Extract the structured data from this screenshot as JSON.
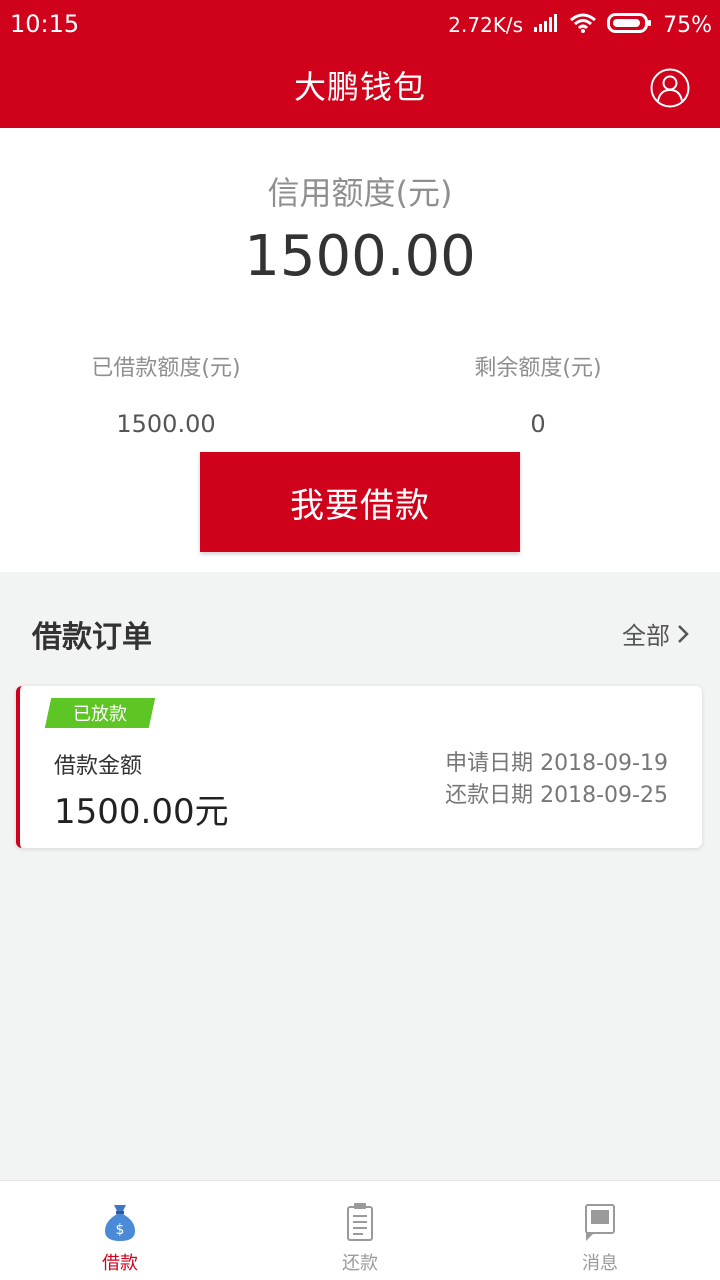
{
  "status": {
    "time": "10:15",
    "speed": "2.72K/s",
    "battery": "75%"
  },
  "header": {
    "title": "大鹏钱包"
  },
  "credit": {
    "label": "信用额度(元)",
    "value": "1500.00",
    "borrowed_label": "已借款额度(元)",
    "borrowed_value": "1500.00",
    "remaining_label": "剩余额度(元)",
    "remaining_value": "0",
    "borrow_button": "我要借款"
  },
  "orders": {
    "title": "借款订单",
    "all_link": "全部",
    "items": [
      {
        "badge": "已放款",
        "amount_label": "借款金额",
        "amount": "1500.00元",
        "apply_date": "申请日期 2018-09-19",
        "repay_date": "还款日期 2018-09-25"
      }
    ]
  },
  "nav": {
    "items": [
      {
        "label": "借款",
        "icon": "money-bag-icon",
        "active": true
      },
      {
        "label": "还款",
        "icon": "clipboard-icon",
        "active": false
      },
      {
        "label": "消息",
        "icon": "message-icon",
        "active": false
      }
    ]
  },
  "colors": {
    "brand": "#d0021b",
    "success": "#5ec624",
    "background": "#f2f3f3"
  }
}
